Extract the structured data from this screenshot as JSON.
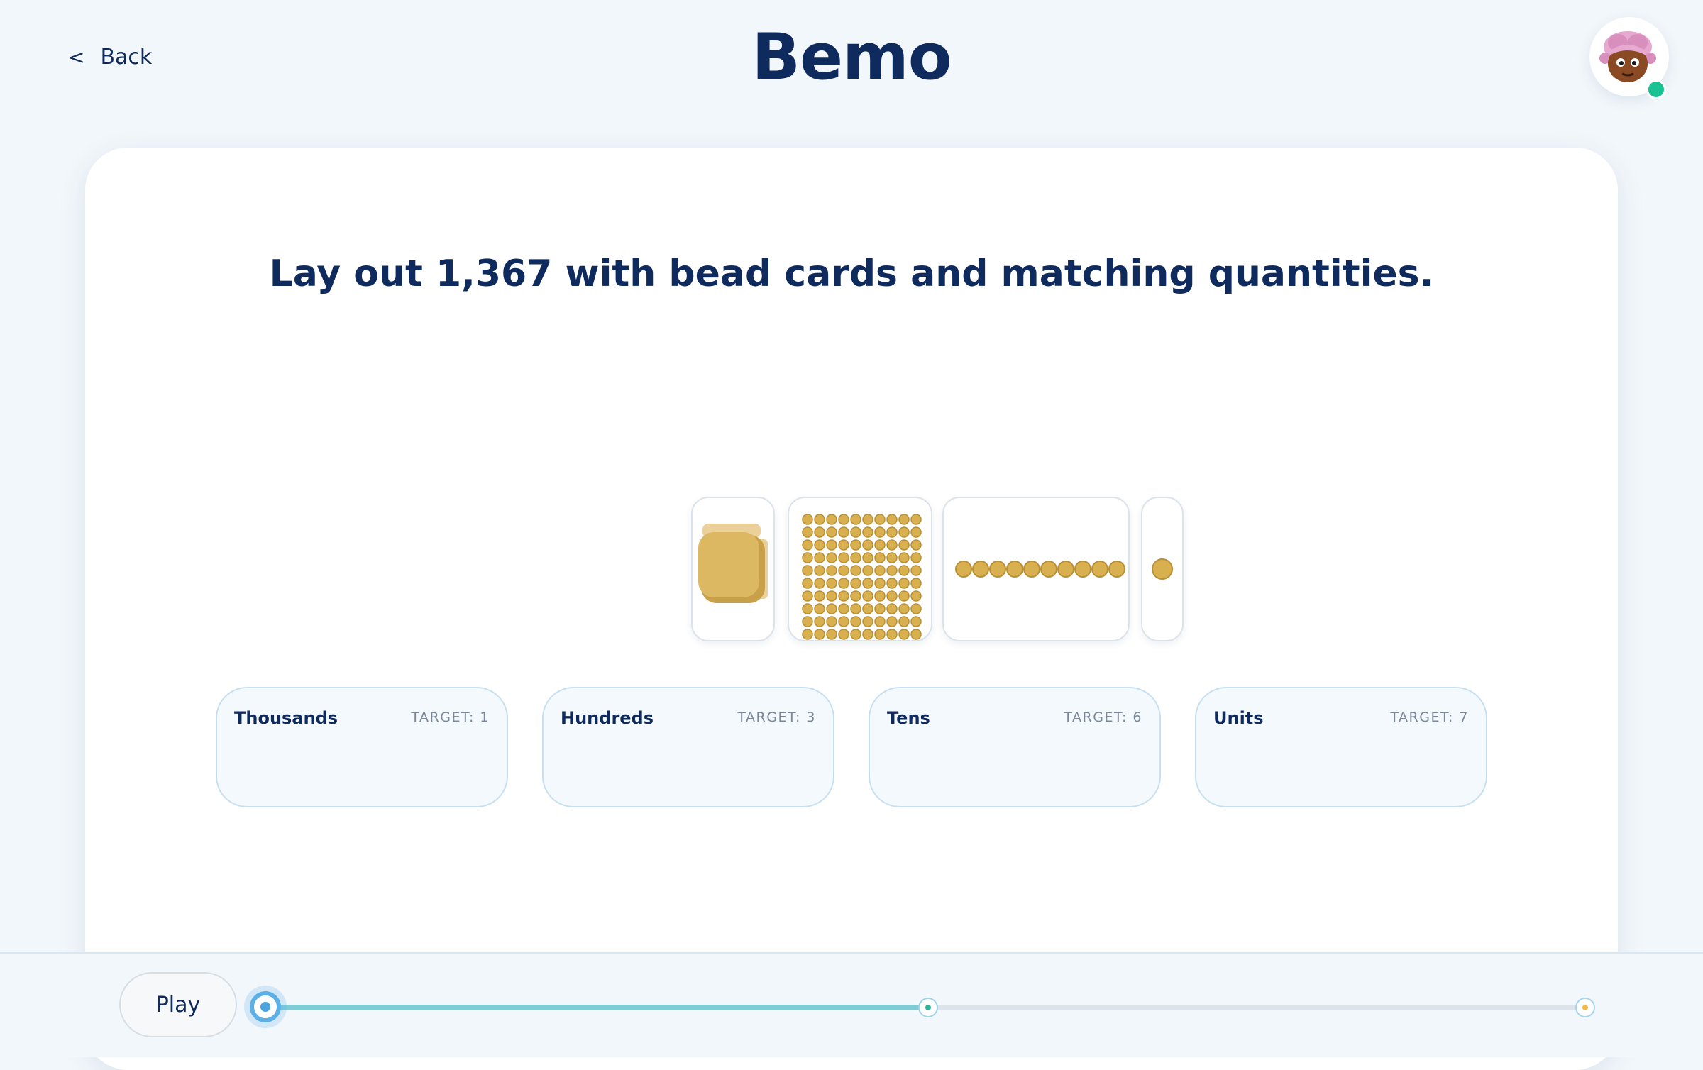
{
  "header": {
    "back_icon": "<",
    "back_label": "Back",
    "app_title": "Bemo",
    "avatar": "character-avatar",
    "status": "online"
  },
  "task": {
    "prompt": "Lay out 1,367 with bead cards and matching quantities."
  },
  "bead_cards": [
    {
      "name": "thousand-cube",
      "icon": "bead-cube-icon"
    },
    {
      "name": "hundred-square",
      "icon": "bead-square-icon"
    },
    {
      "name": "ten-bar",
      "icon": "bead-bar-icon"
    },
    {
      "name": "unit-bead",
      "icon": "bead-unit-icon"
    }
  ],
  "places": [
    {
      "name": "Thousands",
      "target": "TARGET: 1"
    },
    {
      "name": "Hundreds",
      "target": "TARGET: 3"
    },
    {
      "name": "Tens",
      "target": "TARGET: 6"
    },
    {
      "name": "Units",
      "target": "TARGET: 7"
    }
  ],
  "footer": {
    "play_label": "Play",
    "progress": 0.5,
    "checkpoints": 3
  },
  "colors": {
    "navy": "#0f2a5c",
    "bead_gold": "#d9b04f",
    "progress_fill": "#7fcbd6",
    "online": "#19c193"
  }
}
